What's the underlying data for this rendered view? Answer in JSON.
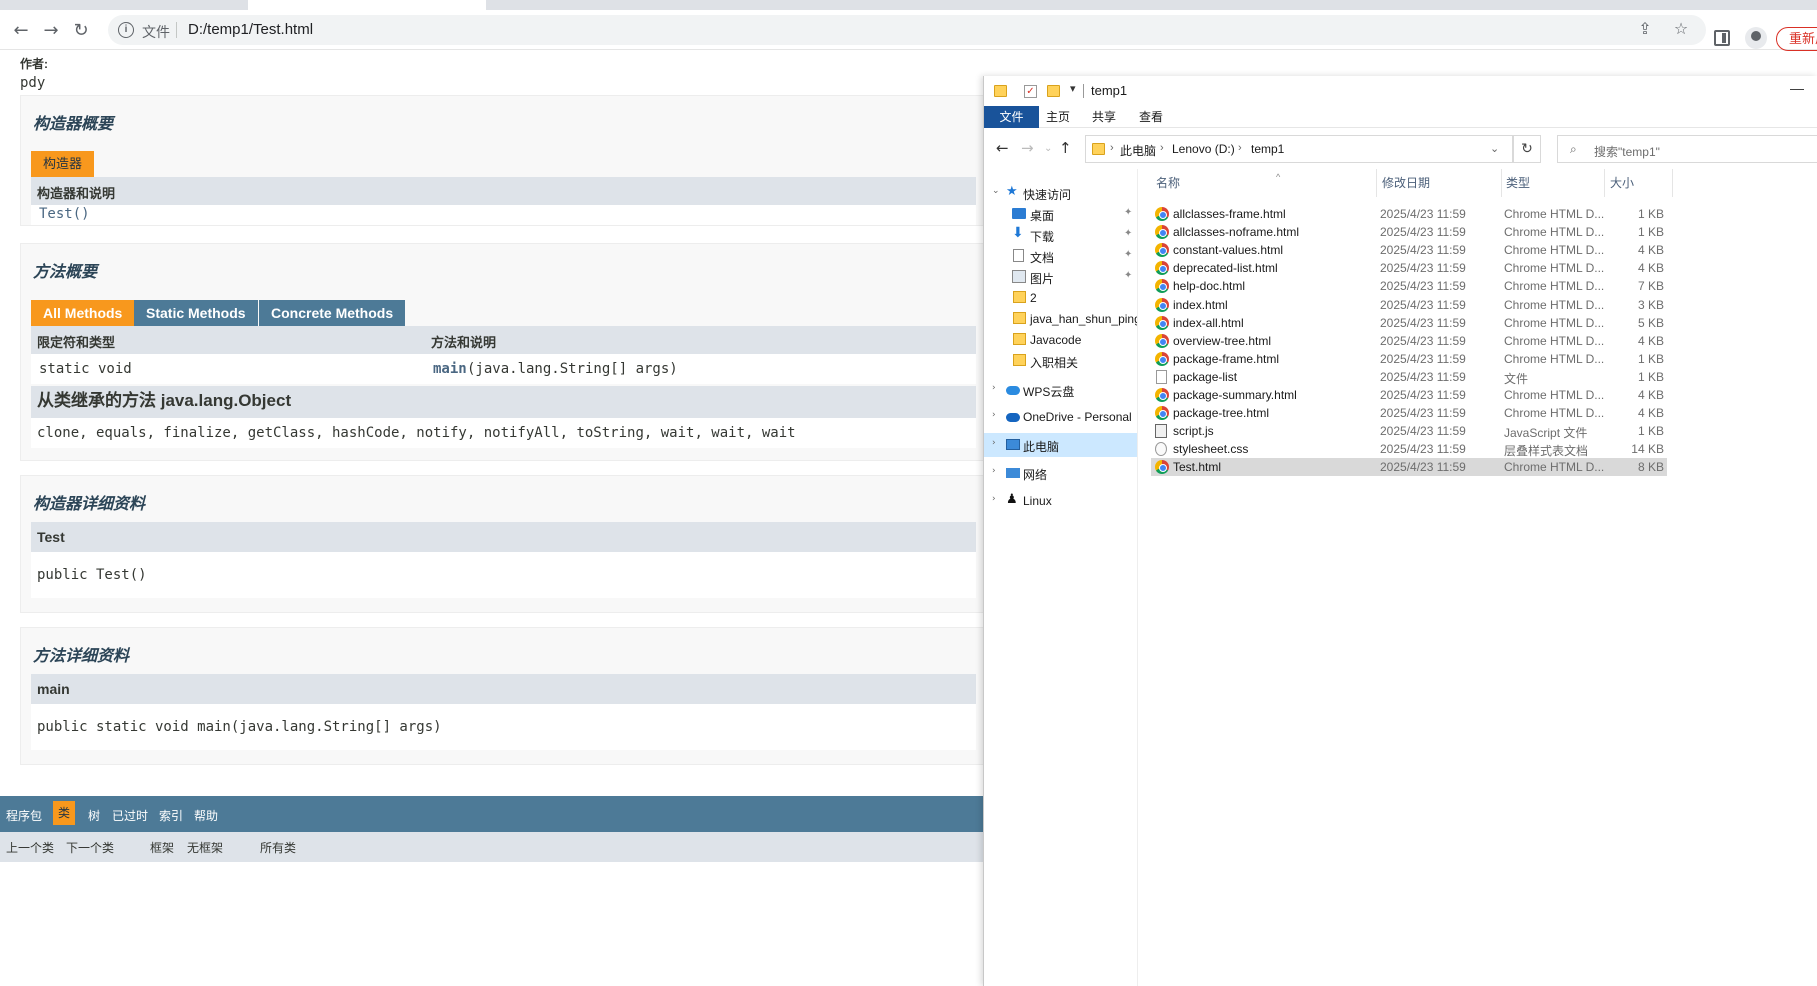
{
  "browser": {
    "scheme_label": "文件",
    "url": "D:/temp1/Test.html",
    "update_label": "重新启动"
  },
  "doc": {
    "author_label": "作者:",
    "author_value": "pdy",
    "constructor_summary": {
      "title": "构造器概要",
      "caption": "构造器",
      "header": "构造器和说明",
      "row": "Test()"
    },
    "method_summary": {
      "title": "方法概要",
      "tabs": [
        "All Methods",
        "Static Methods",
        "Concrete Methods"
      ],
      "header_modifier": "限定符和类型",
      "header_method": "方法和说明",
      "row_modifier": "static void",
      "row_method_name": "main",
      "row_method_params": "(java.lang.String[] args)"
    },
    "inherited": {
      "title": "从类继承的方法 java.lang.Object",
      "methods": "clone, equals, finalize, getClass, hashCode, notify, notifyAll, toString, wait, wait, wait"
    },
    "constructor_detail": {
      "title": "构造器详细资料",
      "name": "Test",
      "signature": "public Test()"
    },
    "method_detail": {
      "title": "方法详细资料",
      "name": "main",
      "signature": "public static void main(java.lang.String[] args)"
    },
    "bottom_nav": {
      "items": [
        "程序包",
        "类",
        "树",
        "已过时",
        "索引",
        "帮助"
      ],
      "current_index": 1
    },
    "sub_nav": {
      "prev": "上一个类",
      "next": "下一个类",
      "frames": "框架",
      "no_frames": "无框架",
      "all_classes": "所有类"
    }
  },
  "explorer": {
    "title": "temp1",
    "ribbon_tabs": [
      "文件",
      "主页",
      "共享",
      "查看"
    ],
    "breadcrumb": [
      "此电脑",
      "Lenovo (D:)",
      "temp1"
    ],
    "search_placeholder": "搜索\"temp1\"",
    "nav": {
      "quick_access": "快速访问",
      "items": [
        "桌面",
        "下载",
        "文档",
        "图片",
        "2",
        "java_han_shun_ping",
        "Javacode",
        "入职相关"
      ],
      "wps": "WPS云盘",
      "onedrive": "OneDrive - Personal",
      "this_pc": "此电脑",
      "network": "网络",
      "linux": "Linux"
    },
    "columns": [
      "名称",
      "修改日期",
      "类型",
      "大小"
    ],
    "files": [
      {
        "name": "allclasses-frame.html",
        "date": "2025/4/23 11:59",
        "type": "Chrome HTML D...",
        "size": "1 KB",
        "icon": "chrome-icon"
      },
      {
        "name": "allclasses-noframe.html",
        "date": "2025/4/23 11:59",
        "type": "Chrome HTML D...",
        "size": "1 KB",
        "icon": "chrome-icon"
      },
      {
        "name": "constant-values.html",
        "date": "2025/4/23 11:59",
        "type": "Chrome HTML D...",
        "size": "4 KB",
        "icon": "chrome-icon"
      },
      {
        "name": "deprecated-list.html",
        "date": "2025/4/23 11:59",
        "type": "Chrome HTML D...",
        "size": "4 KB",
        "icon": "chrome-icon"
      },
      {
        "name": "help-doc.html",
        "date": "2025/4/23 11:59",
        "type": "Chrome HTML D...",
        "size": "7 KB",
        "icon": "chrome-icon"
      },
      {
        "name": "index.html",
        "date": "2025/4/23 11:59",
        "type": "Chrome HTML D...",
        "size": "3 KB",
        "icon": "chrome-icon"
      },
      {
        "name": "index-all.html",
        "date": "2025/4/23 11:59",
        "type": "Chrome HTML D...",
        "size": "5 KB",
        "icon": "chrome-icon"
      },
      {
        "name": "overview-tree.html",
        "date": "2025/4/23 11:59",
        "type": "Chrome HTML D...",
        "size": "4 KB",
        "icon": "chrome-icon"
      },
      {
        "name": "package-frame.html",
        "date": "2025/4/23 11:59",
        "type": "Chrome HTML D...",
        "size": "1 KB",
        "icon": "chrome-icon"
      },
      {
        "name": "package-list",
        "date": "2025/4/23 11:59",
        "type": "文件",
        "size": "1 KB",
        "icon": "file-icon"
      },
      {
        "name": "package-summary.html",
        "date": "2025/4/23 11:59",
        "type": "Chrome HTML D...",
        "size": "4 KB",
        "icon": "chrome-icon"
      },
      {
        "name": "package-tree.html",
        "date": "2025/4/23 11:59",
        "type": "Chrome HTML D...",
        "size": "4 KB",
        "icon": "chrome-icon"
      },
      {
        "name": "script.js",
        "date": "2025/4/23 11:59",
        "type": "JavaScript 文件",
        "size": "1 KB",
        "icon": "script-icon"
      },
      {
        "name": "stylesheet.css",
        "date": "2025/4/23 11:59",
        "type": "层叠样式表文档",
        "size": "14 KB",
        "icon": "stylesheet-icon"
      },
      {
        "name": "Test.html",
        "date": "2025/4/23 11:59",
        "type": "Chrome HTML D...",
        "size": "8 KB",
        "icon": "chrome-icon",
        "selected": true
      }
    ]
  }
}
